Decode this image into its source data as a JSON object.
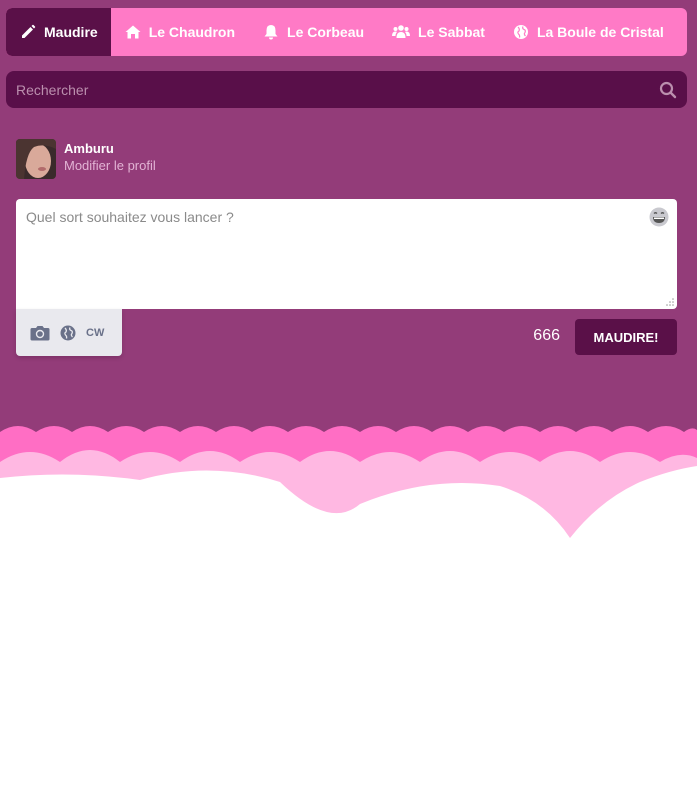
{
  "nav": {
    "items": [
      {
        "label": "Maudire",
        "icon": "pencil-icon"
      },
      {
        "label": "Le Chaudron",
        "icon": "home-icon"
      },
      {
        "label": "Le Corbeau",
        "icon": "bell-icon"
      },
      {
        "label": "Le Sabbat",
        "icon": "users-icon"
      },
      {
        "label": "La Boule de Cristal",
        "icon": "globe-icon"
      }
    ],
    "menu_icon": "hamburger-menu-icon"
  },
  "search": {
    "placeholder": "Rechercher",
    "icon": "search-icon"
  },
  "profile": {
    "name": "Amburu",
    "edit_label": "Modifier le profil"
  },
  "composer": {
    "placeholder": "Quel sort souhaitez vous lancer ?",
    "emoji_icon": "emoji-icon",
    "tools": {
      "camera_icon": "camera-icon",
      "visibility_icon": "globe-icon",
      "cw_label": "CW"
    },
    "char_count": "666",
    "submit_label": "Maudire!"
  },
  "colors": {
    "background": "#933c79",
    "nav": "#ff7ac6",
    "nav_active": "#5a1048",
    "search": "#590f49",
    "button": "#5a1048",
    "scallop_dark": "#ff6ec4",
    "scallop_light": "#ffb8e2"
  }
}
